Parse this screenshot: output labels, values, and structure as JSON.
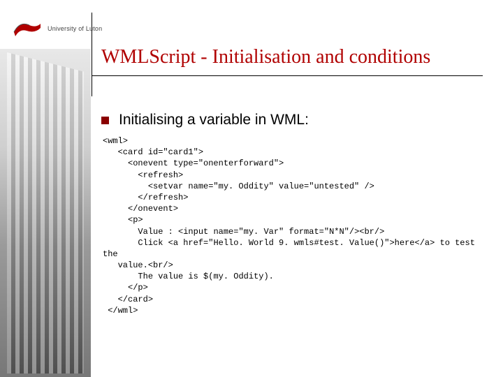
{
  "logo_text": "University of Luton",
  "title": "WMLScript - Initialisation and conditions",
  "bullet1": "Initialising a variable in WML:",
  "code_block": "<wml>\n   <card id=\"card1\">\n     <onevent type=\"onenterforward\">\n       <refresh>\n         <setvar name=\"my. Oddity\" value=\"untested\" />\n       </refresh>\n     </onevent>\n     <p>\n       Value : <input name=\"my. Var\" format=\"N*N\"/><br/>\n       Click <a href=\"Hello. World 9. wmls#test. Value()\">here</a> to test the\n   value.<br/>\n       The value is $(my. Oddity).\n     </p>\n   </card>\n </wml>"
}
